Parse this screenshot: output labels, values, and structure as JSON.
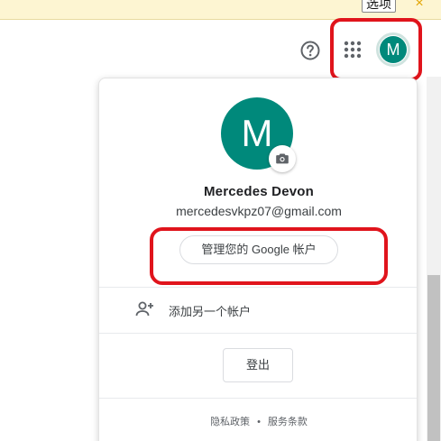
{
  "topbar": {
    "option_label": "选项",
    "close_icon": "×"
  },
  "header": {
    "help_icon": "help-circle-icon",
    "apps_icon": "apps-grid-icon",
    "avatar_initial": "M"
  },
  "account": {
    "avatar_initial": "M",
    "name": "Mercedes Devon",
    "email": "mercedesvkpz07@gmail.com",
    "manage_label": "管理您的 Google 帐户",
    "add_account_label": "添加另一个帐户",
    "sign_out_label": "登出"
  },
  "footer": {
    "privacy_label": "隐私政策",
    "separator": "•",
    "terms_label": "服务条款"
  },
  "colors": {
    "accent": "#00897b",
    "highlight": "#e0141c"
  }
}
